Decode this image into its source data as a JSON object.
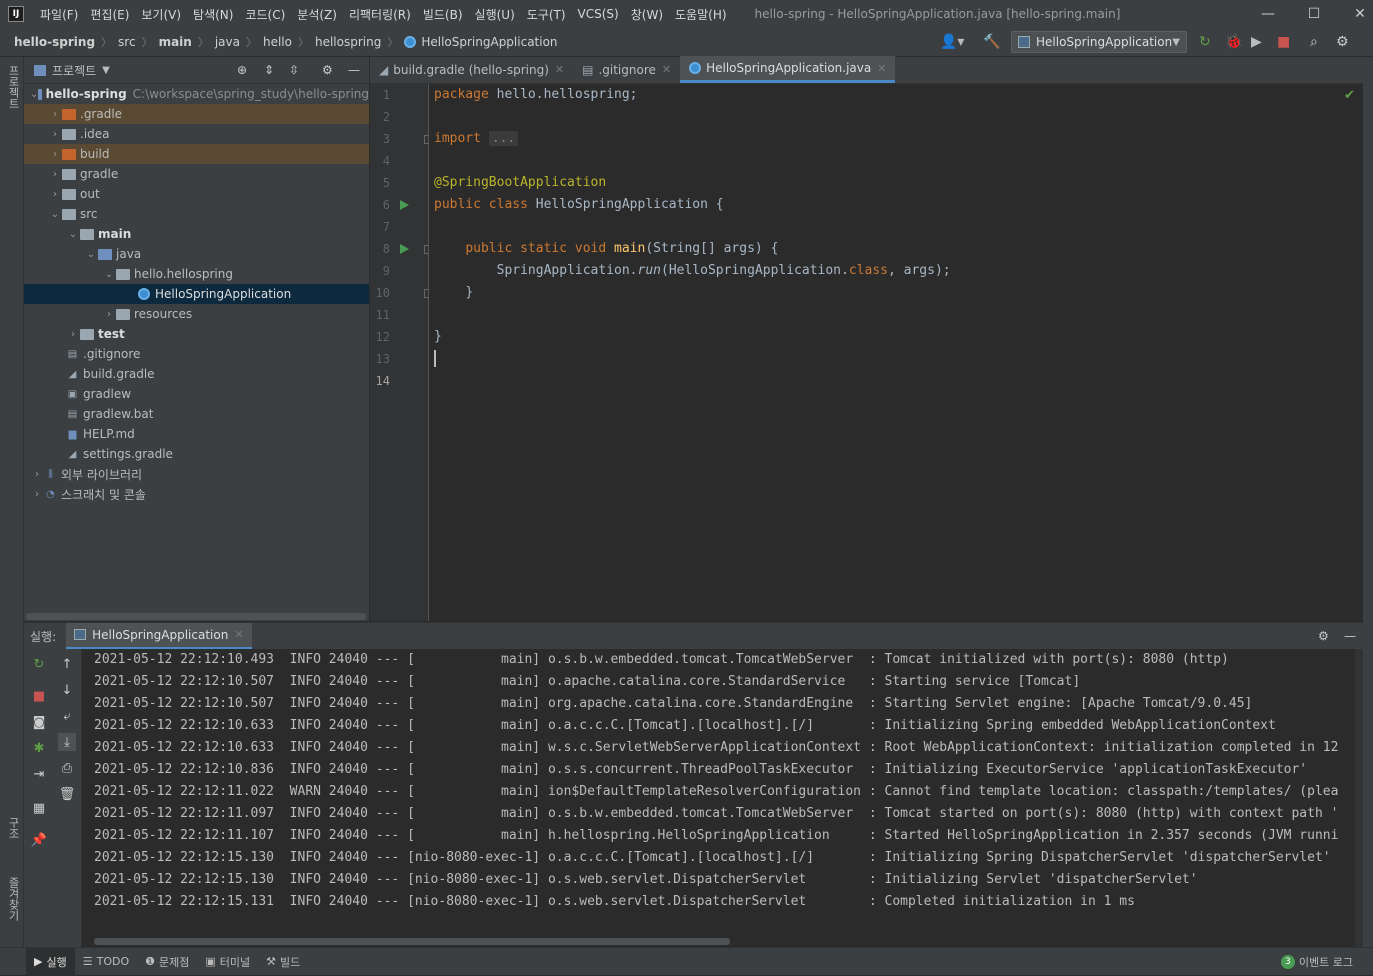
{
  "menubar": {
    "items": [
      "파일(F)",
      "편집(E)",
      "보기(V)",
      "탐색(N)",
      "코드(C)",
      "분석(Z)",
      "리팩터링(R)",
      "빌드(B)",
      "실행(U)",
      "도구(T)",
      "VCS(S)",
      "창(W)",
      "도움말(H)"
    ],
    "title": "hello-spring - HelloSpringApplication.java [hello-spring.main]"
  },
  "breadcrumb": [
    "hello-spring",
    "src",
    "main",
    "java",
    "hello",
    "hellospring",
    "HelloSpringApplication"
  ],
  "toolbar": {
    "run_config": "HelloSpringApplication"
  },
  "left_strip": {
    "project": "프로젝트",
    "structure": "구조",
    "favorites": "즐겨찾기"
  },
  "project_panel": {
    "title": "프로젝트",
    "tree": [
      {
        "label": "hello-spring",
        "path": "C:\\workspace\\spring_study\\hello-spring"
      },
      {
        "label": ".gradle"
      },
      {
        "label": ".idea"
      },
      {
        "label": "build"
      },
      {
        "label": "gradle"
      },
      {
        "label": "out"
      },
      {
        "label": "src"
      },
      {
        "label": "main"
      },
      {
        "label": "java"
      },
      {
        "label": "hello.hellospring"
      },
      {
        "label": "HelloSpringApplication"
      },
      {
        "label": "resources"
      },
      {
        "label": "test"
      },
      {
        "label": ".gitignore"
      },
      {
        "label": "build.gradle"
      },
      {
        "label": "gradlew"
      },
      {
        "label": "gradlew.bat"
      },
      {
        "label": "HELP.md"
      },
      {
        "label": "settings.gradle"
      },
      {
        "label": "외부 라이브러리"
      },
      {
        "label": "스크래치 및 콘솔"
      }
    ]
  },
  "editor_tabs": [
    {
      "label": "build.gradle (hello-spring)"
    },
    {
      "label": ".gitignore"
    },
    {
      "label": "HelloSpringApplication.java"
    }
  ],
  "editor": {
    "line_numbers": [
      "1",
      "2",
      "3",
      "4",
      "5",
      "6",
      "7",
      "8",
      "9",
      "10",
      "11",
      "12",
      "13",
      "14"
    ],
    "code": {
      "l1_kw": "package",
      "l1_rest": " hello.hellospring;",
      "l3_kw": "import",
      "l3_fold": "...",
      "l6": "@SpringBootApplication",
      "l7_kw": "public class",
      "l7_rest": " HelloSpringApplication {",
      "l9_kw": "public static void",
      "l9_fn": "main",
      "l9_rest": "(String[] args) {",
      "l10_a": "SpringApplication.",
      "l10_b": "run",
      "l10_c": "(HelloSpringApplication.",
      "l10_d": "class",
      "l10_e": ", args);",
      "l11": "}",
      "l13": "}"
    }
  },
  "run_panel": {
    "label": "실행:",
    "tab": "HelloSpringApplication",
    "logs": [
      "2021-05-12 22:12:10.493  INFO 24040 --- [           main] o.s.b.w.embedded.tomcat.TomcatWebServer  : Tomcat initialized with port(s): 8080 (http)",
      "2021-05-12 22:12:10.507  INFO 24040 --- [           main] o.apache.catalina.core.StandardService   : Starting service [Tomcat]",
      "2021-05-12 22:12:10.507  INFO 24040 --- [           main] org.apache.catalina.core.StandardEngine  : Starting Servlet engine: [Apache Tomcat/9.0.45]",
      "2021-05-12 22:12:10.633  INFO 24040 --- [           main] o.a.c.c.C.[Tomcat].[localhost].[/]       : Initializing Spring embedded WebApplicationContext",
      "2021-05-12 22:12:10.633  INFO 24040 --- [           main] w.s.c.ServletWebServerApplicationContext : Root WebApplicationContext: initialization completed in 12",
      "2021-05-12 22:12:10.836  INFO 24040 --- [           main] o.s.s.concurrent.ThreadPoolTaskExecutor  : Initializing ExecutorService 'applicationTaskExecutor'",
      "2021-05-12 22:12:11.022  WARN 24040 --- [           main] ion$DefaultTemplateResolverConfiguration : Cannot find template location: classpath:/templates/ (plea",
      "2021-05-12 22:12:11.097  INFO 24040 --- [           main] o.s.b.w.embedded.tomcat.TomcatWebServer  : Tomcat started on port(s): 8080 (http) with context path '",
      "2021-05-12 22:12:11.107  INFO 24040 --- [           main] h.hellospring.HelloSpringApplication     : Started HelloSpringApplication in 2.357 seconds (JVM runni",
      "2021-05-12 22:12:15.130  INFO 24040 --- [nio-8080-exec-1] o.a.c.c.C.[Tomcat].[localhost].[/]       : Initializing Spring DispatcherServlet 'dispatcherServlet'",
      "2021-05-12 22:12:15.130  INFO 24040 --- [nio-8080-exec-1] o.s.web.servlet.DispatcherServlet        : Initializing Servlet 'dispatcherServlet'",
      "2021-05-12 22:12:15.131  INFO 24040 --- [nio-8080-exec-1] o.s.web.servlet.DispatcherServlet        : Completed initialization in 1 ms"
    ]
  },
  "statusbar": {
    "items": [
      "실행",
      "TODO",
      "문제점",
      "터미널",
      "빌드"
    ],
    "events_count": "3",
    "events_label": "이벤트 로그"
  },
  "colors": {
    "accent": "#4a88c7",
    "run_green": "#499c54",
    "keyword": "#cc7832",
    "annotation": "#bbb529",
    "method": "#ffc66d",
    "selection": "#0d293e"
  }
}
